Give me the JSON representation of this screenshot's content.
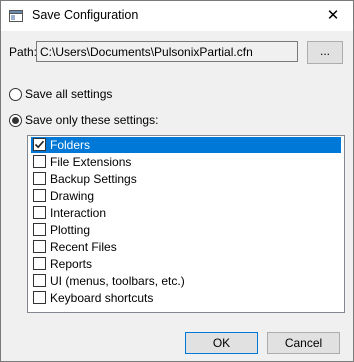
{
  "window": {
    "title": "Save Configuration",
    "close_icon": "close-icon"
  },
  "path": {
    "label": "Path:",
    "value": "C:\\Users\\Documents\\PulsonixPartial.cfn",
    "browse_label": "..."
  },
  "options": {
    "save_all_label": "Save all settings",
    "save_only_label": "Save only these settings:",
    "selected": "save_only"
  },
  "settings": [
    {
      "label": "Folders",
      "checked": true,
      "selected": true
    },
    {
      "label": "File Extensions",
      "checked": false,
      "selected": false
    },
    {
      "label": "Backup Settings",
      "checked": false,
      "selected": false
    },
    {
      "label": "Drawing",
      "checked": false,
      "selected": false
    },
    {
      "label": "Interaction",
      "checked": false,
      "selected": false
    },
    {
      "label": "Plotting",
      "checked": false,
      "selected": false
    },
    {
      "label": "Recent Files",
      "checked": false,
      "selected": false
    },
    {
      "label": "Reports",
      "checked": false,
      "selected": false
    },
    {
      "label": "UI (menus, toolbars, etc.)",
      "checked": false,
      "selected": false
    },
    {
      "label": "Keyboard shortcuts",
      "checked": false,
      "selected": false
    }
  ],
  "buttons": {
    "ok_label": "OK",
    "cancel_label": "Cancel"
  },
  "colors": {
    "selection": "#0078d7",
    "dialog_bg": "#f0f0f0"
  }
}
